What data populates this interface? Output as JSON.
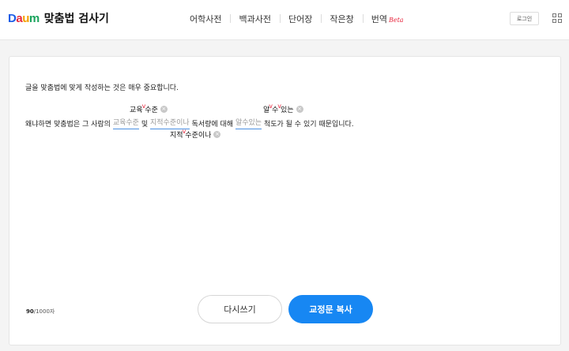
{
  "header": {
    "logo_letters": [
      "D",
      "a",
      "u",
      "m"
    ],
    "title": "맞춤법 검사기",
    "nav": [
      "어학사전",
      "백과사전",
      "단어장",
      "작은창",
      "번역"
    ],
    "beta_label": "Beta",
    "login_label": "로그인",
    "grid_icon": "grid-icon"
  },
  "editor": {
    "line1": "글을 맞춤법에 맞게 작성하는 것은 매우 중요합니다.",
    "line2": {
      "part1": "왜냐하면 맞춤법은 그 사람의",
      "err1": "교육수준",
      "part2": "및",
      "err2": "지적수준이나",
      "part3": "독서량에 대해",
      "err3": "알수있는",
      "part4": "척도가 될 수 있기 때문입니다."
    },
    "suggestions": {
      "s1_a": "교육",
      "s1_b": "수준",
      "s2_a": "지적",
      "s2_b": "수준이나",
      "s3_a": "알",
      "s3_b": "수",
      "s3_c": "있는"
    },
    "caret_glyph": "v",
    "remove_glyph": "×"
  },
  "footer": {
    "count": "90",
    "count_suffix": "/1000자",
    "rewrite_label": "다시쓰기",
    "copy_label": "교정문 복사"
  },
  "colors": {
    "accent": "#1787f3",
    "error_red": "#e8283f",
    "underline_blue": "#4a90e2"
  }
}
